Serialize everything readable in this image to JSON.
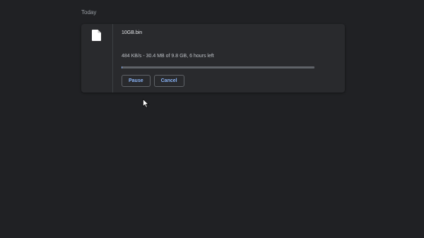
{
  "section": {
    "label": "Today"
  },
  "download": {
    "icon": "file-icon",
    "file_name": "10GB.bin",
    "status": "484 KB/s - 30.4 MB of 9.8 GB, 6 hours left",
    "progress_fraction": 0.003,
    "accent_color": "#8ab4f8",
    "buttons": {
      "pause": "Pause",
      "cancel": "Cancel"
    }
  }
}
